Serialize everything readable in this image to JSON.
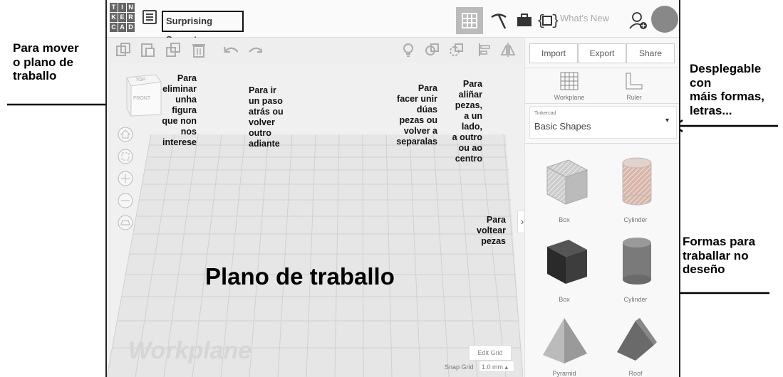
{
  "app": {
    "logo_letters": [
      "T",
      "I",
      "N",
      "K",
      "E",
      "R",
      "C",
      "A",
      "D"
    ],
    "project_title": "Surprising Snaget",
    "whats_new_label": "What's New",
    "import_label": "Import",
    "export_label": "Export",
    "share_label": "Share",
    "workplane_tool_label": "Workplane",
    "ruler_tool_label": "Ruler",
    "shape_source_small": "Tinkercad",
    "shape_category": "Basic Shapes",
    "shapes": [
      {
        "label": "Box",
        "icon": "striped-box"
      },
      {
        "label": "Cylinder",
        "icon": "striped-cylinder"
      },
      {
        "label": "Box",
        "icon": "solid-box"
      },
      {
        "label": "Cylinder",
        "icon": "solid-cylinder"
      },
      {
        "label": "Pyramid",
        "icon": "pyramid"
      },
      {
        "label": "Roof",
        "icon": "roof"
      }
    ],
    "viewcube_top": "TOP",
    "viewcube_front": "FRONT",
    "workplane_watermark": "Workplane",
    "edit_grid_label": "Edit Grid",
    "snap_grid_label": "Snap Grid",
    "snap_grid_value": "1.0 mm",
    "collapse_glyph": "›"
  },
  "annotations": {
    "left_move": "Para mover\no plano de\ntraballo",
    "delete": "Para\neliminar\nunha\nfigura\nque non\nnos\ninterese",
    "undo_redo": "Para ir\nun paso\natrás ou\nvolver\noutro\nadiante",
    "group": "Para\nfacer unir\ndúas\npezas ou\nvolver a\nseparalas",
    "align": "Para\naliñar\npezas,\na un\nlado,\na outro\nou ao\ncentro",
    "flip": "Para\nvoltear\npezas",
    "dropdown": "Desplegable con\nmáis formas,\nletras...",
    "shapes": "Formas para\ntraballar no\ndeseño",
    "workplane_big": "Plano de traballo"
  }
}
